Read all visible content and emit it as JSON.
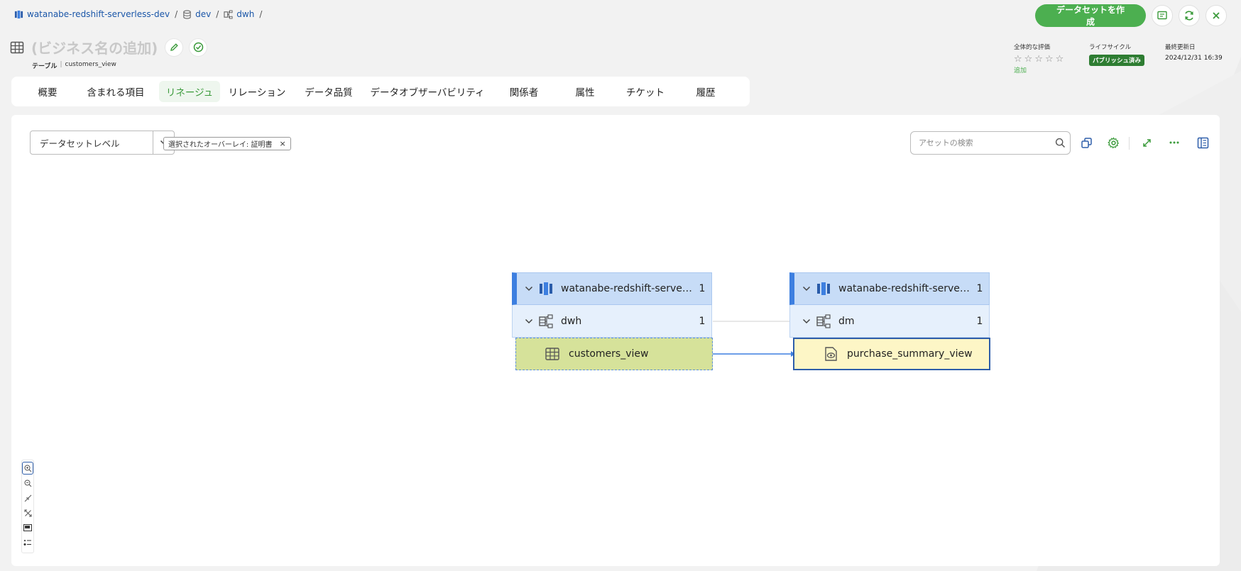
{
  "breadcrumb": {
    "items": [
      {
        "label": "watanabe-redshift-serverless-dev",
        "icon": "redshift-icon"
      },
      {
        "label": "dev",
        "icon": "database-icon"
      },
      {
        "label": "dwh",
        "icon": "schema-icon"
      }
    ],
    "separator": "/"
  },
  "header": {
    "create_dataset_label": "データセットを作成",
    "business_name_placeholder": "(ビジネス名の追加)",
    "object_type": "テーブル",
    "object_name": "customers_view"
  },
  "meta": {
    "rating_label": "全体的な評価",
    "rating_value": 0,
    "rating_max": 5,
    "add_label": "追加",
    "lifecycle_label": "ライフサイクル",
    "lifecycle_value": "パブリッシュ済み",
    "updated_label": "最終更新日",
    "updated_value": "2024/12/31 16:39"
  },
  "tabs": [
    {
      "label": "概要"
    },
    {
      "label": "含まれる項目"
    },
    {
      "label": "リネージュ",
      "active": true
    },
    {
      "label": "リレーション"
    },
    {
      "label": "データ品質"
    },
    {
      "label": "データオブザーバビリティ"
    },
    {
      "label": "関係者"
    },
    {
      "label": "属性"
    },
    {
      "label": "チケット"
    },
    {
      "label": "履歴"
    }
  ],
  "toolbar": {
    "level_select_value": "データセットレベル",
    "overlay_chip_label": "選択されたオーバーレイ: 証明書",
    "overlay_chip_close": "×",
    "search_placeholder": "アセットの検索"
  },
  "lineage": {
    "source": {
      "database": {
        "name": "watanabe-redshift-serverless-dev",
        "count": "1"
      },
      "schema": {
        "name": "dwh",
        "count": "1"
      },
      "table": {
        "name": "customers_view"
      }
    },
    "target": {
      "database": {
        "name": "watanabe-redshift-serverless-dev",
        "count": "1"
      },
      "schema": {
        "name": "dm",
        "count": "1"
      },
      "table": {
        "name": "purchase_summary_view"
      }
    }
  },
  "colors": {
    "accent_green": "#4caf50",
    "lifecycle_badge": "#2e7d32",
    "node_header": "#c7dcf7",
    "node_sub": "#e6f0fc",
    "source_leaf": "#d6e29a",
    "target_leaf": "#fdf6c6",
    "edge": "#3d7fe0"
  }
}
